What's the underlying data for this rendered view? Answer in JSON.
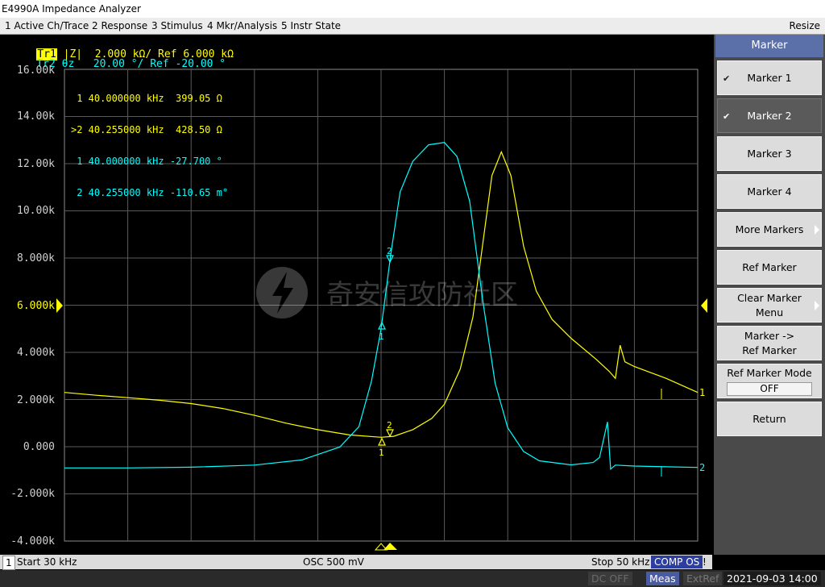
{
  "window": {
    "title": "E4990A Impedance Analyzer"
  },
  "menu": {
    "items": [
      "1 Active Ch/Trace",
      "2 Response",
      "3 Stimulus",
      "4 Mkr/Analysis",
      "5 Instr State"
    ],
    "resize": "Resize"
  },
  "traces": {
    "tr1": {
      "id": "Tr1",
      "param": "|Z|",
      "scale": "2.000 kΩ/ Ref 6.000 kΩ",
      "color": "#ffff00"
    },
    "tr2": {
      "id": "Tr2",
      "param": "θz",
      "scale": "20.00 °/ Ref -20.00 °",
      "color": "#00ffff"
    }
  },
  "markers_readout": [
    {
      "text": " 1 40.000000 kHz  399.05 Ω",
      "color": "#ffff00"
    },
    {
      "text": ">2 40.255000 kHz  428.50 Ω",
      "color": "#ffff00"
    },
    {
      "text": " 1 40.000000 kHz -27.700 °",
      "color": "#00ffff"
    },
    {
      "text": " 2 40.255000 kHz -110.65 m°",
      "color": "#00ffff"
    }
  ],
  "yaxis": {
    "labels": [
      "16.00k",
      "14.00k",
      "12.00k",
      "10.00k",
      "8.000k",
      "6.000k",
      "4.000k",
      "2.000k",
      "0.000",
      "-2.000k",
      "-4.000k"
    ],
    "ref_label": "6.000k"
  },
  "trace_end_labels": {
    "tr1": "1",
    "tr2": "2"
  },
  "marker_labels": {
    "m1": "1",
    "m2": "2"
  },
  "chart_data": {
    "type": "line",
    "x_start_khz": 30,
    "x_stop_khz": 50,
    "ylim": [
      -4000,
      16000
    ],
    "grid": true,
    "series": [
      {
        "name": "Tr1 |Z|",
        "color": "#ffff00",
        "points": [
          [
            30,
            2300
          ],
          [
            31,
            2180
          ],
          [
            32,
            2080
          ],
          [
            33,
            1970
          ],
          [
            34,
            1830
          ],
          [
            35,
            1620
          ],
          [
            36,
            1330
          ],
          [
            37,
            1000
          ],
          [
            38,
            720
          ],
          [
            39,
            500
          ],
          [
            40,
            399
          ],
          [
            40.4,
            440
          ],
          [
            41,
            720
          ],
          [
            41.6,
            1200
          ],
          [
            42,
            1800
          ],
          [
            42.5,
            3300
          ],
          [
            42.9,
            5500
          ],
          [
            43.2,
            8500
          ],
          [
            43.5,
            11500
          ],
          [
            43.8,
            12500
          ],
          [
            44.1,
            11500
          ],
          [
            44.5,
            8500
          ],
          [
            44.9,
            6600
          ],
          [
            45.4,
            5400
          ],
          [
            46,
            4600
          ],
          [
            46.8,
            3700
          ],
          [
            47.2,
            3200
          ],
          [
            47.4,
            2900
          ],
          [
            47.55,
            4300
          ],
          [
            47.7,
            3600
          ],
          [
            48,
            3400
          ],
          [
            49,
            2900
          ],
          [
            50,
            2300
          ]
        ]
      },
      {
        "name": "Tr2 θz",
        "color": "#00ffff",
        "points": [
          [
            30,
            -900
          ],
          [
            32,
            -900
          ],
          [
            34,
            -870
          ],
          [
            36,
            -780
          ],
          [
            37.5,
            -560
          ],
          [
            38.7,
            -10
          ],
          [
            39.3,
            850
          ],
          [
            39.7,
            2800
          ],
          [
            40,
            5000
          ],
          [
            40.3,
            8100
          ],
          [
            40.6,
            10800
          ],
          [
            41,
            12100
          ],
          [
            41.5,
            12800
          ],
          [
            42,
            12900
          ],
          [
            42.4,
            12300
          ],
          [
            42.8,
            10400
          ],
          [
            43.2,
            6300
          ],
          [
            43.6,
            2700
          ],
          [
            44,
            800
          ],
          [
            44.5,
            -200
          ],
          [
            45,
            -600
          ],
          [
            46,
            -770
          ],
          [
            46.7,
            -670
          ],
          [
            46.9,
            -450
          ],
          [
            47.05,
            450
          ],
          [
            47.15,
            1050
          ],
          [
            47.25,
            -950
          ],
          [
            47.4,
            -780
          ],
          [
            48,
            -820
          ],
          [
            49,
            -850
          ],
          [
            50,
            -880
          ]
        ]
      }
    ]
  },
  "softkeys": {
    "title": "Marker",
    "buttons": [
      {
        "label": "Marker 1",
        "checked": "✔"
      },
      {
        "label": "Marker 2",
        "checked": "✔"
      },
      {
        "label": "Marker 3"
      },
      {
        "label": "Marker 4"
      },
      {
        "label": "More Markers"
      },
      {
        "label": "Ref Marker"
      },
      {
        "label": "Clear Marker\nMenu"
      },
      {
        "label": "Marker ->\nRef Marker"
      },
      {
        "label": "Ref Marker Mode",
        "value": "OFF"
      },
      {
        "label": "Return"
      }
    ]
  },
  "status": {
    "channel": "1",
    "start": "Start 30 kHz",
    "osc": "OSC 500 mV",
    "stop": "Stop 50 kHz",
    "comp": "COMP OS",
    "bang": "!"
  },
  "bottom": {
    "dc": "DC OFF",
    "meas": "Meas",
    "extref": "ExtRef",
    "datetime": "2021-09-03 14:00"
  },
  "watermark": "奇安信攻防社区"
}
